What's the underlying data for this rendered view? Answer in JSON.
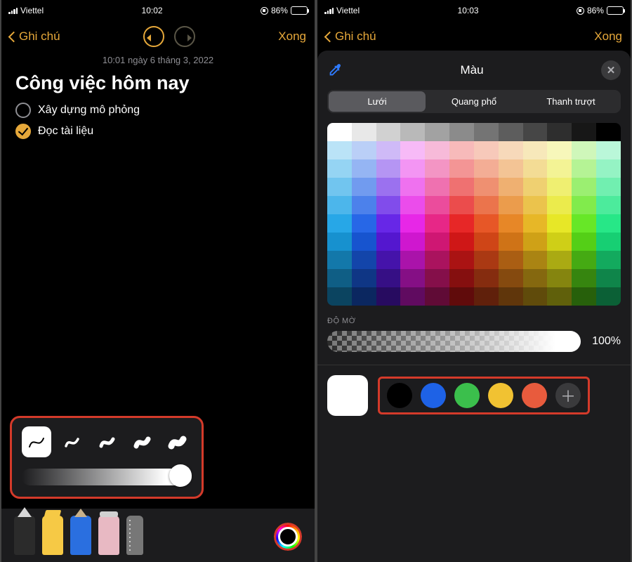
{
  "accent": "#e6a83a",
  "highlight_border": "#d43a2a",
  "left": {
    "status": {
      "carrier": "Viettel",
      "time": "10:02",
      "battery_pct": "86%"
    },
    "nav": {
      "back": "Ghi chú",
      "done": "Xong"
    },
    "timestamp": "10:01 ngày 6 tháng 3, 2022",
    "title": "Công việc hôm nay",
    "todos": [
      {
        "text": "Xây dựng mô phỏng",
        "checked": false
      },
      {
        "text": "Đọc tài liệu",
        "checked": true
      }
    ],
    "stroke_panel": {
      "stroke_icons": [
        "stroke-thin",
        "stroke-2",
        "stroke-3",
        "stroke-4",
        "stroke-thick"
      ],
      "selected_index": 0,
      "opacity_slider_value": 1.0
    },
    "toolbar": {
      "tools": [
        "pen",
        "highlighter",
        "pencil",
        "eraser",
        "ruler"
      ],
      "color_wheel": "color-wheel"
    }
  },
  "right": {
    "status": {
      "carrier": "Viettel",
      "time": "10:03",
      "battery_pct": "86%"
    },
    "nav": {
      "back": "Ghi chú",
      "done": "Xong"
    },
    "picker": {
      "title": "Màu",
      "tabs": {
        "grid": "Lưới",
        "spectrum": "Quang phổ",
        "sliders": "Thanh trượt"
      },
      "active_tab": "grid",
      "opacity_label": "ĐỘ MỜ",
      "opacity_value": "100%",
      "opacity_slider_value": 1.0,
      "current_color": "#ffffff",
      "preset_swatches": [
        "#000000",
        "#1e62e6",
        "#3bbf4c",
        "#f1c232",
        "#e85b3d"
      ],
      "add_swatch_icon": "plus-icon"
    }
  }
}
